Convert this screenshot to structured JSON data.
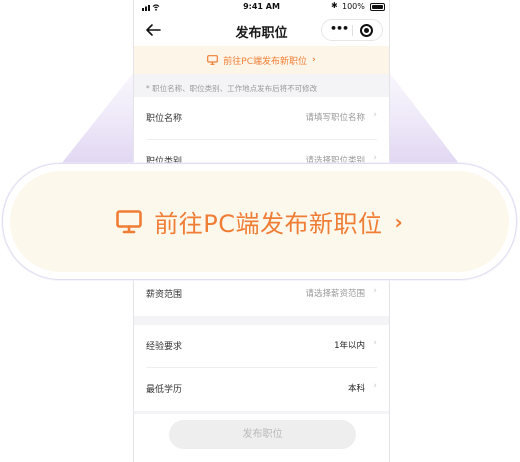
{
  "status_bar": {
    "time": "9:41 AM",
    "battery": "100%"
  },
  "nav": {
    "title": "发布职位"
  },
  "pc_banner": {
    "label": "前往PC端发布新职位"
  },
  "note": "* 职位名称、职位类别、工作地点发布后将不可修改",
  "form_rows_top": [
    {
      "label": "职位名称",
      "value": "请填写职位名称"
    },
    {
      "label": "职位类别",
      "value": "请选择职位类别"
    }
  ],
  "salary_row": {
    "label": "薪资范围",
    "value": "请选择薪资范围"
  },
  "form_rows_bottom": [
    {
      "label": "经验要求",
      "value": "1年以内"
    },
    {
      "label": "最低学历",
      "value": "本科"
    }
  ],
  "publish_button": "发布职位",
  "colors": {
    "accent": "#f07d35",
    "banner_bg": "#fdf6e8",
    "magnifier_border": "#e2dcf2"
  }
}
